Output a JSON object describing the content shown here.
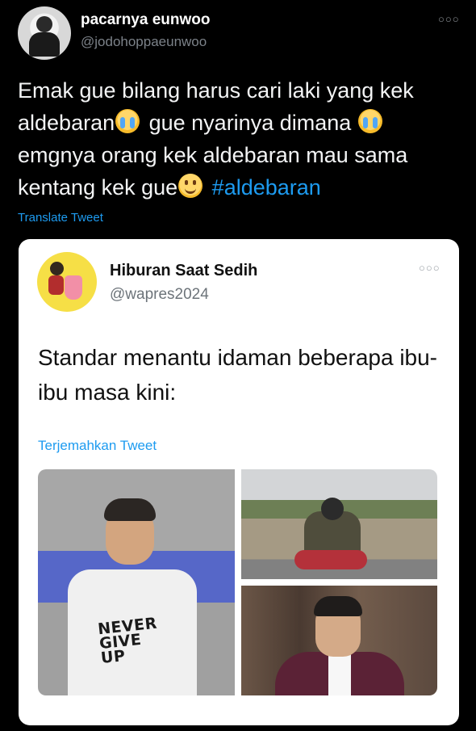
{
  "outer_tweet": {
    "display_name": "pacarnya eunwoo",
    "handle": "@jodohoppaeunwoo",
    "text_part1": "Emak gue bilang harus cari laki yang kek aldebaran",
    "text_part2": " gue nyarinya dimana ",
    "text_part3": " emgnya orang kek aldebaran mau sama kentang kek gue",
    "hashtag": "#aldebaran",
    "translate_label": "Translate Tweet",
    "more_icon": "more-horizontal-icon"
  },
  "quoted_tweet": {
    "display_name": "Hiburan Saat Sedih",
    "handle": "@wapres2024",
    "text": "Standar menantu idaman beberapa ibu-ibu masa kini:",
    "translate_label": "Terjemahkan Tweet",
    "more_icon": "more-horizontal-icon",
    "images": {
      "left_shirt_text": "NEVER\nGIVE\nUP"
    }
  },
  "colors": {
    "background": "#000000",
    "link": "#1d9bf0",
    "card": "#ffffff"
  }
}
